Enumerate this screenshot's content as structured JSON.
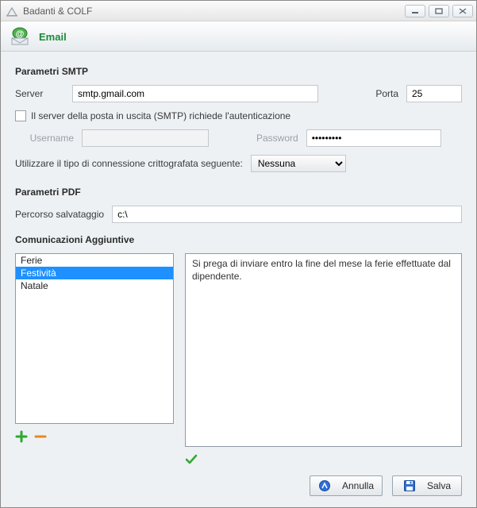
{
  "window_title": "Badanti & COLF",
  "header": {
    "title": "Email"
  },
  "smtp": {
    "section": "Parametri SMTP",
    "server_label": "Server",
    "server_value": "smtp.gmail.com",
    "port_label": "Porta",
    "port_value": "25",
    "auth_label": "Il server della posta in uscita (SMTP) richiede l'autenticazione",
    "auth_checked": false,
    "username_label": "Username",
    "username_value": "",
    "password_label": "Password",
    "password_value": "•••••••••",
    "encryption_label": "Utilizzare il tipo di connessione crittografata seguente:",
    "encryption_selected": "Nessuna"
  },
  "pdf": {
    "section": "Parametri PDF",
    "path_label": "Percorso salvataggio",
    "path_value": "c:\\"
  },
  "comm": {
    "section": "Comunicazioni Aggiuntive",
    "items": [
      "Ferie",
      "Festività",
      "Natale"
    ],
    "selected_index": 1,
    "text": "Si prega di inviare entro la fine del mese la ferie effettuate dal dipendente."
  },
  "buttons": {
    "cancel": "Annulla",
    "save": "Salva"
  }
}
